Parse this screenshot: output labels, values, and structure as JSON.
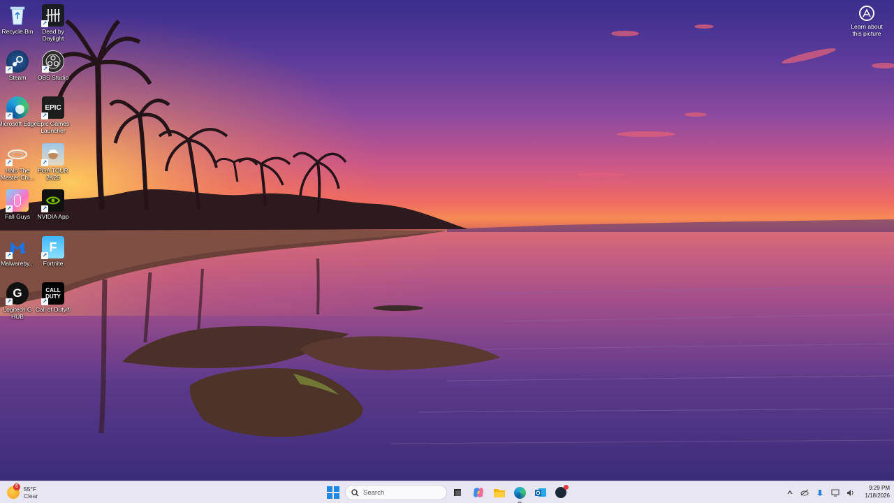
{
  "desktop": {
    "icons": [
      {
        "label": "Recycle Bin",
        "icon": "recycle-bin-icon"
      },
      {
        "label": "Dead by Daylight",
        "icon": "dead-by-daylight-icon"
      },
      {
        "label": "Steam",
        "icon": "steam-icon"
      },
      {
        "label": "OBS Studio",
        "icon": "obs-studio-icon"
      },
      {
        "label": "Microsoft Edge",
        "icon": "edge-icon"
      },
      {
        "label": "Epic Games Launcher",
        "icon": "epic-games-icon",
        "glyph": "EPIC"
      },
      {
        "label": "Halo The Master Chi...",
        "icon": "halo-icon"
      },
      {
        "label": "PGA TOUR 2K25",
        "icon": "pga-tour-icon"
      },
      {
        "label": "Fall Guys",
        "icon": "fall-guys-icon"
      },
      {
        "label": "NVIDIA App",
        "icon": "nvidia-icon"
      },
      {
        "label": "Malwareby...",
        "icon": "malwarebytes-icon"
      },
      {
        "label": "Fortnite",
        "icon": "fortnite-icon",
        "glyph": "F"
      },
      {
        "label": "Logitech G HUB",
        "icon": "logitech-g-hub-icon",
        "glyph": "G"
      },
      {
        "label": "Call of Duty®",
        "icon": "call-of-duty-icon",
        "glyph": "CALL DUTY"
      }
    ],
    "learn_about": {
      "label": "Learn about this picture",
      "icon": "learn-about-picture-icon"
    }
  },
  "taskbar": {
    "weather": {
      "temperature": "55°F",
      "condition": "Clear",
      "badge": "6",
      "icon": "weather-clear-icon"
    },
    "search": {
      "label": "Search",
      "icon": "search-icon"
    },
    "apps": [
      {
        "name": "Task View",
        "icon": "task-view-icon"
      },
      {
        "name": "Copilot",
        "icon": "copilot-icon"
      },
      {
        "name": "File Explorer",
        "icon": "file-explorer-icon"
      },
      {
        "name": "Microsoft Edge",
        "icon": "edge-icon"
      },
      {
        "name": "Outlook",
        "icon": "outlook-icon"
      },
      {
        "name": "Steam",
        "icon": "steam-icon"
      }
    ],
    "tray": [
      "chevron-up-icon",
      "network-icon",
      "onedrive-icon",
      "display-icon",
      "volume-icon"
    ],
    "clock": {
      "time": "9:29 PM",
      "date": "1/18/2026"
    }
  },
  "colors": {
    "start_blue": "#1e88e5",
    "taskbar_bg": "#e8e6f0"
  }
}
